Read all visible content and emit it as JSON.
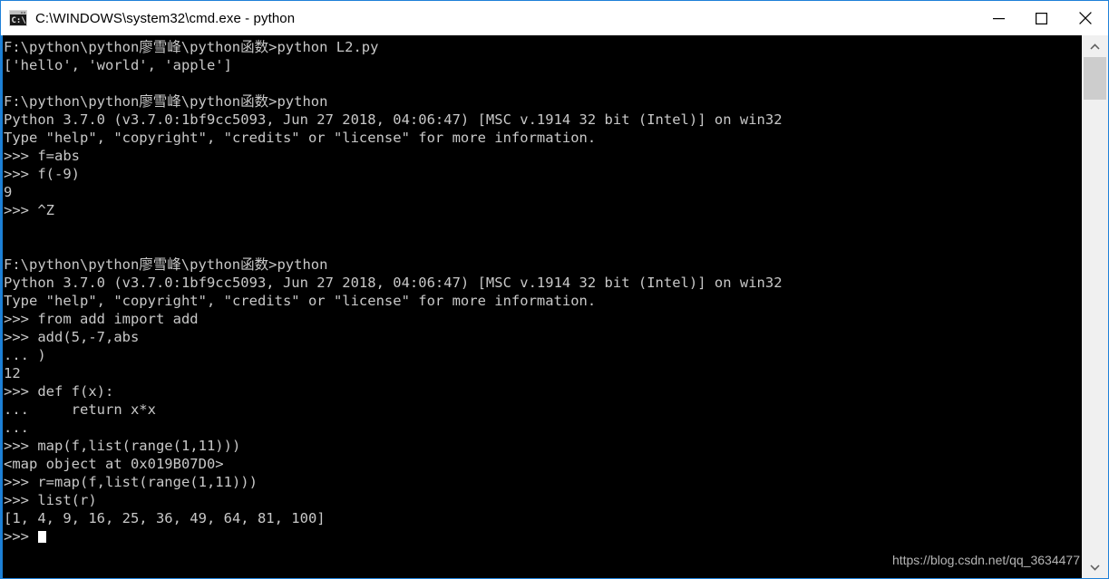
{
  "window": {
    "title": "C:\\WINDOWS\\system32\\cmd.exe - python",
    "icon": "cmd-console-icon",
    "border_color": "#1e80d8",
    "titlebar_bg": "#ffffff",
    "console_bg": "#000000",
    "console_fg": "#c8c8c8",
    "controls": {
      "minimize": "minimize-icon",
      "maximize": "maximize-icon",
      "close": "close-icon"
    }
  },
  "scrollbar": {
    "up_arrow": "chevron-up-icon",
    "down_arrow": "chevron-down-icon",
    "track_color": "#f0f0f0",
    "thumb_color": "#cdcdcd"
  },
  "watermark": {
    "text": "https://blog.csdn.net/qq_3634477"
  },
  "console": {
    "prompt": ">>>",
    "continuation": "...",
    "cursor": "block-cursor",
    "lines": [
      "F:\\python\\python廖雪峰\\python函数>python L2.py",
      "['hello', 'world', 'apple']",
      "",
      "F:\\python\\python廖雪峰\\python函数>python",
      "Python 3.7.0 (v3.7.0:1bf9cc5093, Jun 27 2018, 04:06:47) [MSC v.1914 32 bit (Intel)] on win32",
      "Type \"help\", \"copyright\", \"credits\" or \"license\" for more information.",
      ">>> f=abs",
      ">>> f(-9)",
      "9",
      ">>> ^Z",
      "",
      "",
      "F:\\python\\python廖雪峰\\python函数>python",
      "Python 3.7.0 (v3.7.0:1bf9cc5093, Jun 27 2018, 04:06:47) [MSC v.1914 32 bit (Intel)] on win32",
      "Type \"help\", \"copyright\", \"credits\" or \"license\" for more information.",
      ">>> from add import add",
      ">>> add(5,-7,abs",
      "... )",
      "12",
      ">>> def f(x):",
      "...     return x*x",
      "...",
      ">>> map(f,list(range(1,11)))",
      "<map object at 0x019B07D0>",
      ">>> r=map(f,list(range(1,11)))",
      ">>> list(r)",
      "[1, 4, 9, 16, 25, 36, 49, 64, 81, 100]",
      ">>> "
    ]
  }
}
